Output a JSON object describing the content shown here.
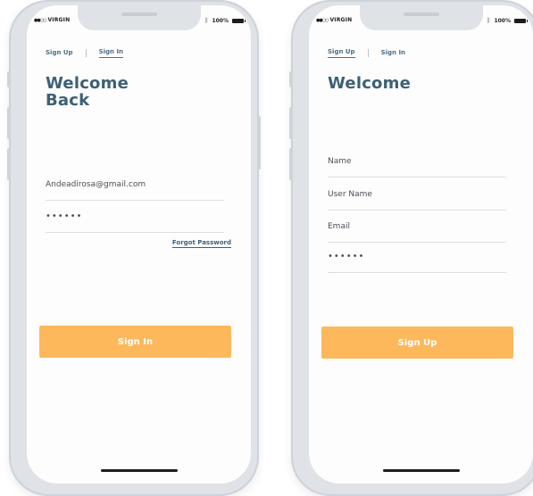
{
  "status_bar": {
    "carrier": "VIRGIN",
    "battery": "100%"
  },
  "signin_screen": {
    "tabs": [
      {
        "label": "Sign Up"
      },
      {
        "label": "Sign In"
      }
    ],
    "title_line1": "Welcome",
    "title_line2": "Back",
    "email_value": "Andeadirosa@gmail.com",
    "password_value": "••••••",
    "forgot_label": "Forgot Password",
    "button_label": "Sign In"
  },
  "signup_screen": {
    "tabs": [
      {
        "label": "Sign Up"
      },
      {
        "label": "Sign In"
      }
    ],
    "title": "Welcome",
    "name_placeholder": "Name",
    "username_placeholder": "User Name",
    "email_placeholder": "Email",
    "password_value": "••••••",
    "button_label": "Sign Up"
  },
  "colors": {
    "accent": "#fdb85c",
    "title": "#3d6075",
    "tab_text": "#4f6f82",
    "phone_frame": "#dfe2e7"
  }
}
